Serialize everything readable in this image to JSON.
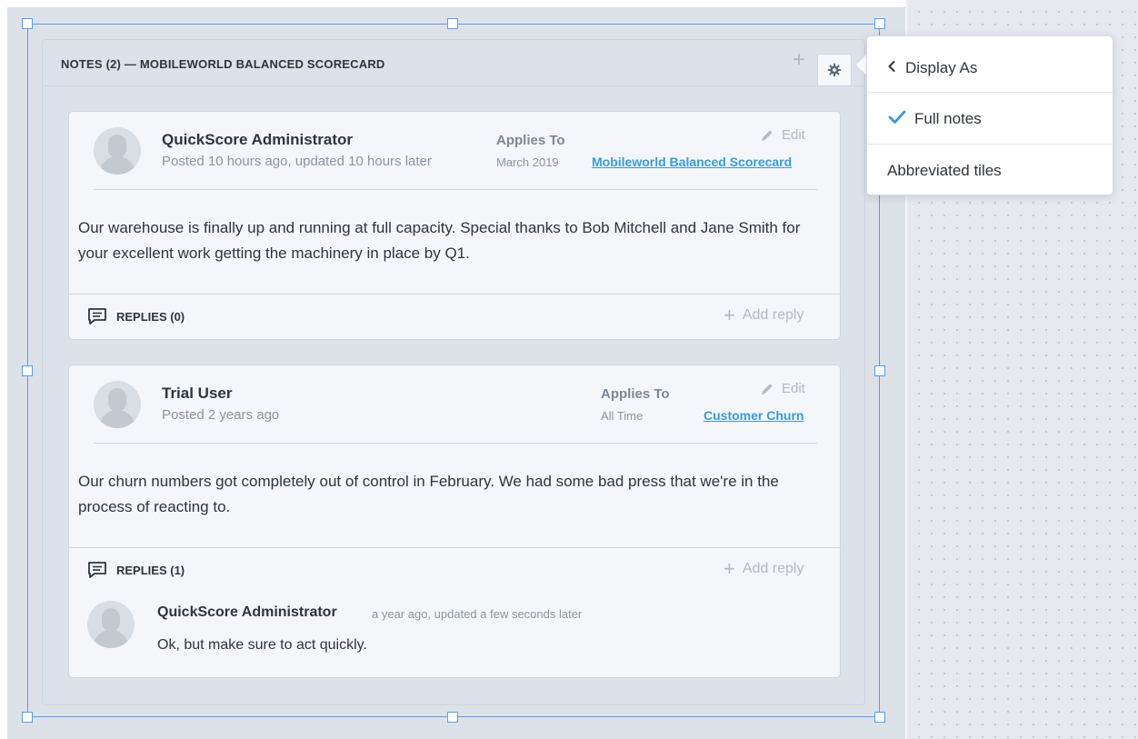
{
  "widget": {
    "title": "NOTES (2) — MOBILEWORLD BALANCED SCORECARD",
    "add_icon": "plus-icon",
    "settings_icon": "gear-icon"
  },
  "notes": [
    {
      "author": "QuickScore Administrator",
      "posted": "Posted 10 hours ago, updated 10 hours later",
      "applies_label": "Applies To",
      "applies_period": "March 2019",
      "applies_link": "Mobileworld Balanced Scorecard",
      "edit_label": "Edit",
      "body": "Our warehouse is finally up and running at full capacity. Special thanks to Bob Mitchell and Jane Smith for your excellent work getting the machinery in place by Q1.",
      "replies_label": "REPLIES (0)",
      "add_reply_label": "Add reply"
    },
    {
      "author": "Trial User",
      "posted": "Posted 2 years ago",
      "applies_label": "Applies To",
      "applies_period": "All Time",
      "applies_link": "Customer Churn",
      "edit_label": "Edit",
      "body": "Our churn numbers got completely out of control in February. We had some bad press that we're in the process of reacting to.",
      "replies_label": "REPLIES (1)",
      "add_reply_label": "Add reply",
      "replies": [
        {
          "author": "QuickScore Administrator",
          "meta": "a year ago, updated a few seconds later",
          "text": "Ok, but make sure to act quickly."
        }
      ]
    }
  ],
  "display_menu": {
    "title": "Display As",
    "options": [
      {
        "label": "Full notes",
        "selected": true
      },
      {
        "label": "Abbreviated tiles",
        "selected": false
      }
    ]
  },
  "colors": {
    "accent": "#3a9ad9",
    "selection": "#5b9cf0"
  }
}
